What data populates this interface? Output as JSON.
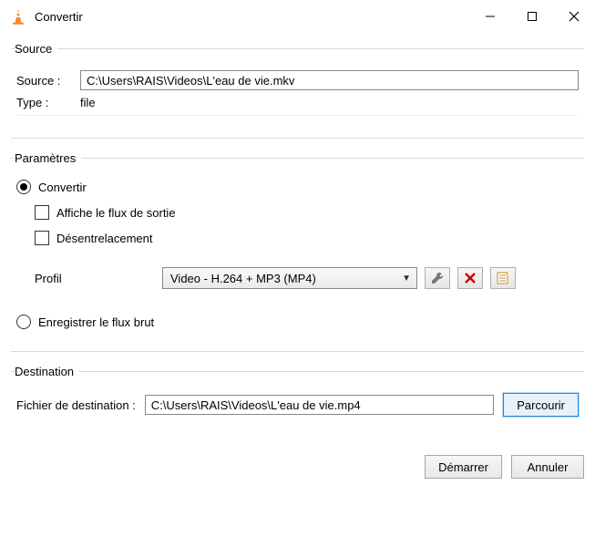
{
  "window": {
    "title": "Convertir"
  },
  "source": {
    "legend": "Source",
    "source_label": "Source :",
    "source_value": "C:\\Users\\RAIS\\Videos\\L'eau de vie.mkv",
    "type_label": "Type :",
    "type_value": "file"
  },
  "params": {
    "legend": "Paramètres",
    "convert_label": "Convertir",
    "show_output_label": "Affiche le flux de sortie",
    "deinterlace_label": "Désentrelacement",
    "profile_label": "Profil",
    "profile_value": "Video - H.264 + MP3 (MP4)",
    "dump_raw_label": "Enregistrer le flux brut"
  },
  "destination": {
    "legend": "Destination",
    "file_label": "Fichier de destination :",
    "file_value": "C:\\Users\\RAIS\\Videos\\L'eau de vie.mp4",
    "browse_label": "Parcourir"
  },
  "footer": {
    "start_label": "Démarrer",
    "cancel_label": "Annuler"
  }
}
